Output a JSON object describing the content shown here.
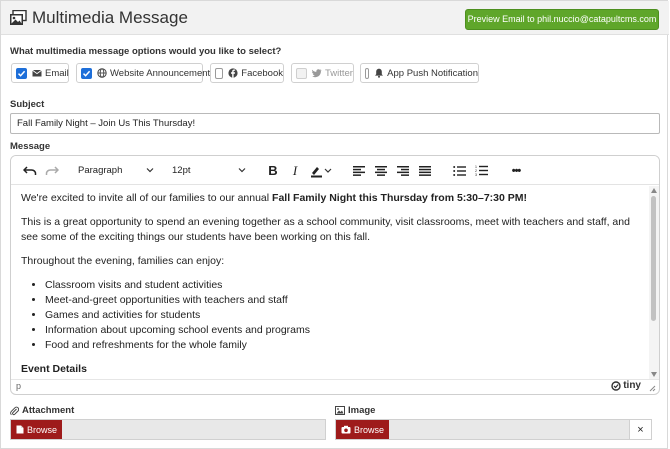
{
  "header": {
    "title": "Multimedia Message",
    "preview_button": "Preview Email to phil.nuccio@catapultcms.com"
  },
  "options": {
    "question": "What multimedia message options would you like to select?",
    "items": [
      {
        "label": "Email",
        "checked": true,
        "icon": "envelope-icon"
      },
      {
        "label": "Website Announcement",
        "checked": true,
        "icon": "globe-icon"
      },
      {
        "label": "Facebook",
        "checked": false,
        "icon": "facebook-icon"
      },
      {
        "label": "Twitter",
        "checked": false,
        "icon": "twitter-icon",
        "disabled": true
      },
      {
        "label": "App Push Notification",
        "checked": false,
        "icon": "bell-icon"
      }
    ]
  },
  "subject": {
    "label": "Subject",
    "value": "Fall Family Night – Join Us This Thursday!"
  },
  "message": {
    "label": "Message",
    "toolbar": {
      "block_format": "Paragraph",
      "font_size": "12pt",
      "more": "•••"
    },
    "body": {
      "p1_pre": "We're excited to invite all of our families to our annual ",
      "p1_bold": "Fall Family Night this Thursday from 5:30–7:30 PM!",
      "p2": "This is a great opportunity to spend an evening together as a school community, visit classrooms, meet with teachers and staff, and see some of the exciting things our students have been working on this fall.",
      "p3": "Throughout the evening, families can enjoy:",
      "list": [
        "Classroom visits and student activities",
        "Meet-and-greet opportunities with teachers and staff",
        "Games and activities for students",
        "Information about upcoming school events and programs",
        "Food and refreshments for the whole family"
      ],
      "heading": "Event Details"
    },
    "status_path": "p",
    "brand": "tiny"
  },
  "attachment": {
    "label": "Attachment",
    "browse": "Browse"
  },
  "image": {
    "label": "Image",
    "browse": "Browse",
    "clear": "×"
  },
  "colors": {
    "preview_green": "#5fa62a",
    "browse_red": "#9e1b1b",
    "checkbox_blue": "#1e6fd9"
  }
}
